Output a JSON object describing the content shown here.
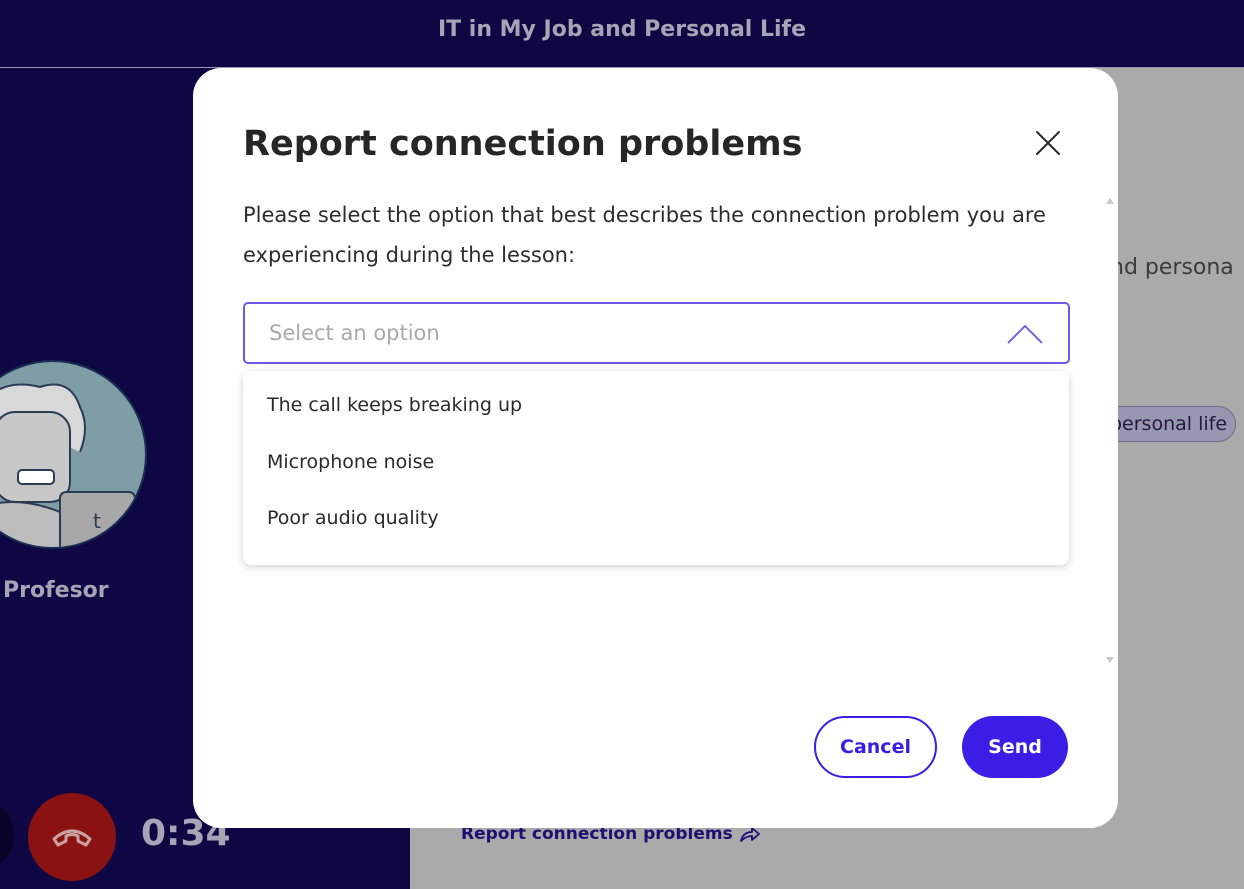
{
  "header": {
    "title": "IT in My Job and Personal Life"
  },
  "call": {
    "teacher_name": "Profesor",
    "timer": "0:34",
    "end_call_icon": "phone-hangup-icon"
  },
  "lesson_panel": {
    "title_fragment": "nd persona",
    "tag_fragment": "personal life",
    "report_link": "Report connection problems",
    "report_link_icon": "share-arrow-icon"
  },
  "modal": {
    "title": "Report connection problems",
    "close_icon": "close-icon",
    "description": "Please select the option that best describes the connection problem you are experiencing during the lesson:",
    "select": {
      "placeholder": "Select an option",
      "icon": "chevron-up-icon",
      "options": [
        "The call keeps breaking up",
        "Microphone noise",
        "Poor audio quality"
      ]
    },
    "buttons": {
      "cancel": "Cancel",
      "send": "Send"
    }
  },
  "colors": {
    "app_background": "#0f0644",
    "accent": "#3a1ee6",
    "select_border": "#6f58e8",
    "end_call": "#8a1212"
  }
}
